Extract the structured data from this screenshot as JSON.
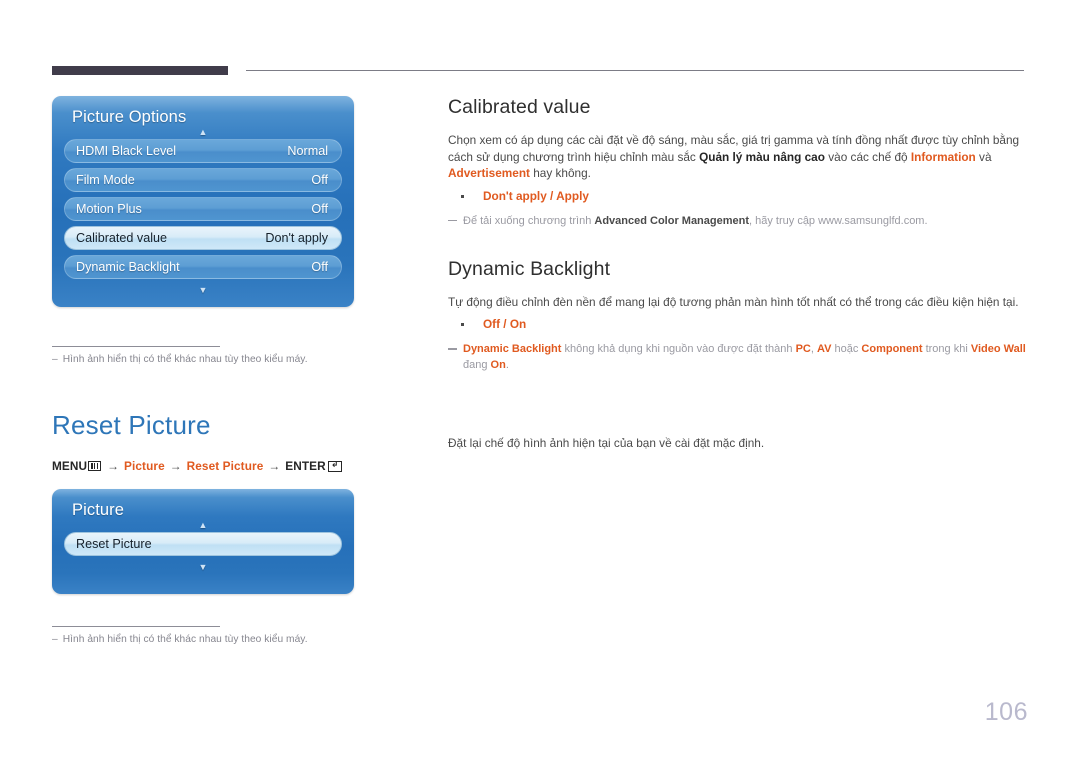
{
  "page": {
    "number": "106"
  },
  "left_column": {
    "osd_picture_options": {
      "title": "Picture Options",
      "up_arrow": "▲",
      "down_arrow": "▼",
      "rows": [
        {
          "label": "HDMI Black Level",
          "value": "Normal",
          "selected": false
        },
        {
          "label": "Film Mode",
          "value": "Off",
          "selected": false
        },
        {
          "label": "Motion Plus",
          "value": "Off",
          "selected": false
        },
        {
          "label": "Calibrated value",
          "value": "Don't apply",
          "selected": true
        },
        {
          "label": "Dynamic Backlight",
          "value": "Off",
          "selected": false
        }
      ]
    },
    "footnote_1": {
      "dash": "–",
      "text": "Hình ảnh hiển thị có thể khác nhau tùy theo kiểu máy."
    },
    "reset_picture_heading": "Reset Picture",
    "menu_path": {
      "menu_label": "MENU",
      "menu_icon": "menu-icon",
      "arrow": "→",
      "step_picture": "Picture",
      "step_reset_picture": "Reset Picture",
      "enter_label": "ENTER",
      "enter_icon": "enter-return-icon",
      "enter_glyph": "↲"
    },
    "osd_picture": {
      "title": "Picture",
      "up_arrow": "▲",
      "down_arrow": "▼",
      "rows": [
        {
          "label": "Reset Picture",
          "value": "",
          "selected": true
        }
      ]
    },
    "footnote_2": {
      "dash": "–",
      "text": "Hình ảnh hiển thị có thể khác nhau tùy theo kiểu máy."
    }
  },
  "right_column": {
    "calibrated_value": {
      "heading": "Calibrated value",
      "paragraph_part1": "Chọn xem có áp dụng các cài đặt về độ sáng, màu sắc, giá trị gamma và tính đồng nhất được tùy chỉnh bằng cách sử dụng chương trình hiệu chỉnh màu sắc ",
      "paragraph_bold1": "Quản lý màu nâng cao",
      "paragraph_part2": " vào các chế độ ",
      "paragraph_orange1": "Information",
      "paragraph_part3": " và ",
      "paragraph_orange2": "Advertisement",
      "paragraph_part4": " hay không.",
      "option_line": "Don't apply / Apply",
      "note_part1": "Để tải xuống chương trình ",
      "note_bold": "Advanced Color Management",
      "note_part2": ", hãy truy cập www.samsunglfd.com."
    },
    "dynamic_backlight": {
      "heading": "Dynamic Backlight",
      "paragraph": "Tự động điều chỉnh đèn nền để mang lại độ tương phản màn hình tốt nhất có thể trong các điều kiện hiện tại.",
      "option_line": "Off / On",
      "note_orange1": "Dynamic Backlight",
      "note_part1": " không khả dụng khi nguồn vào được đặt thành ",
      "note_orange2": "PC",
      "note_part2": ", ",
      "note_orange3": "AV",
      "note_part3": " hoặc ",
      "note_orange4": "Component",
      "note_part4": " trong khi ",
      "note_orange5": "Video Wall",
      "note_part5": " đang ",
      "note_orange6": "On",
      "note_part6": "."
    },
    "reset_picture_desc": "Đặt lại chế độ hình ảnh hiện tại của bạn về cài đặt mặc định."
  },
  "colors": {
    "accent_orange": "#e05a20",
    "heading_blue": "#2e76b8",
    "osd_blue": "#2670b9",
    "rule_dark": "#403c4a",
    "page_number": "#b9b9cd"
  }
}
